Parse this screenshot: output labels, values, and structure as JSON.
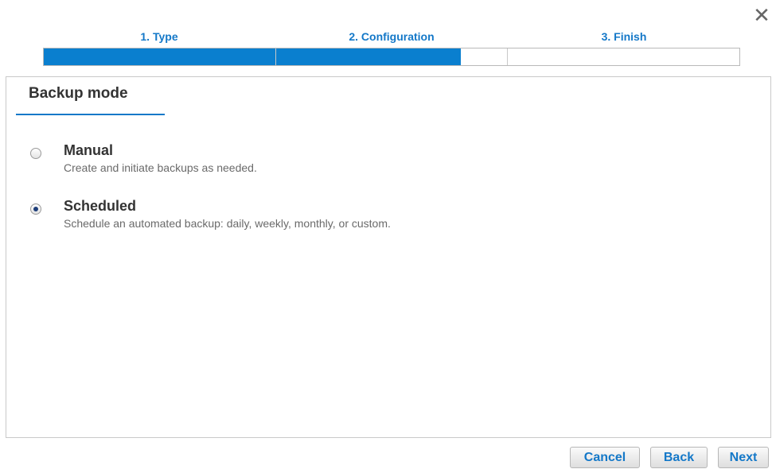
{
  "dialog": {
    "close_glyph": "✕"
  },
  "steps": [
    {
      "label": "1. Type"
    },
    {
      "label": "2. Configuration"
    },
    {
      "label": "3. Finish"
    }
  ],
  "progress": {
    "completed_fraction": 0.6
  },
  "section": {
    "title": "Backup mode"
  },
  "options": [
    {
      "title": "Manual",
      "description": "Create and initiate backups as needed.",
      "selected": false
    },
    {
      "title": "Scheduled",
      "description": "Schedule an automated backup: daily, weekly, monthly, or custom.",
      "selected": true
    }
  ],
  "buttons": {
    "cancel": "Cancel",
    "back": "Back",
    "next": "Next"
  },
  "colors": {
    "accent": "#1478c8",
    "progress_fill": "#0a7fcf"
  },
  "icons": {
    "close": "close-icon",
    "radio": "radio-icon"
  }
}
